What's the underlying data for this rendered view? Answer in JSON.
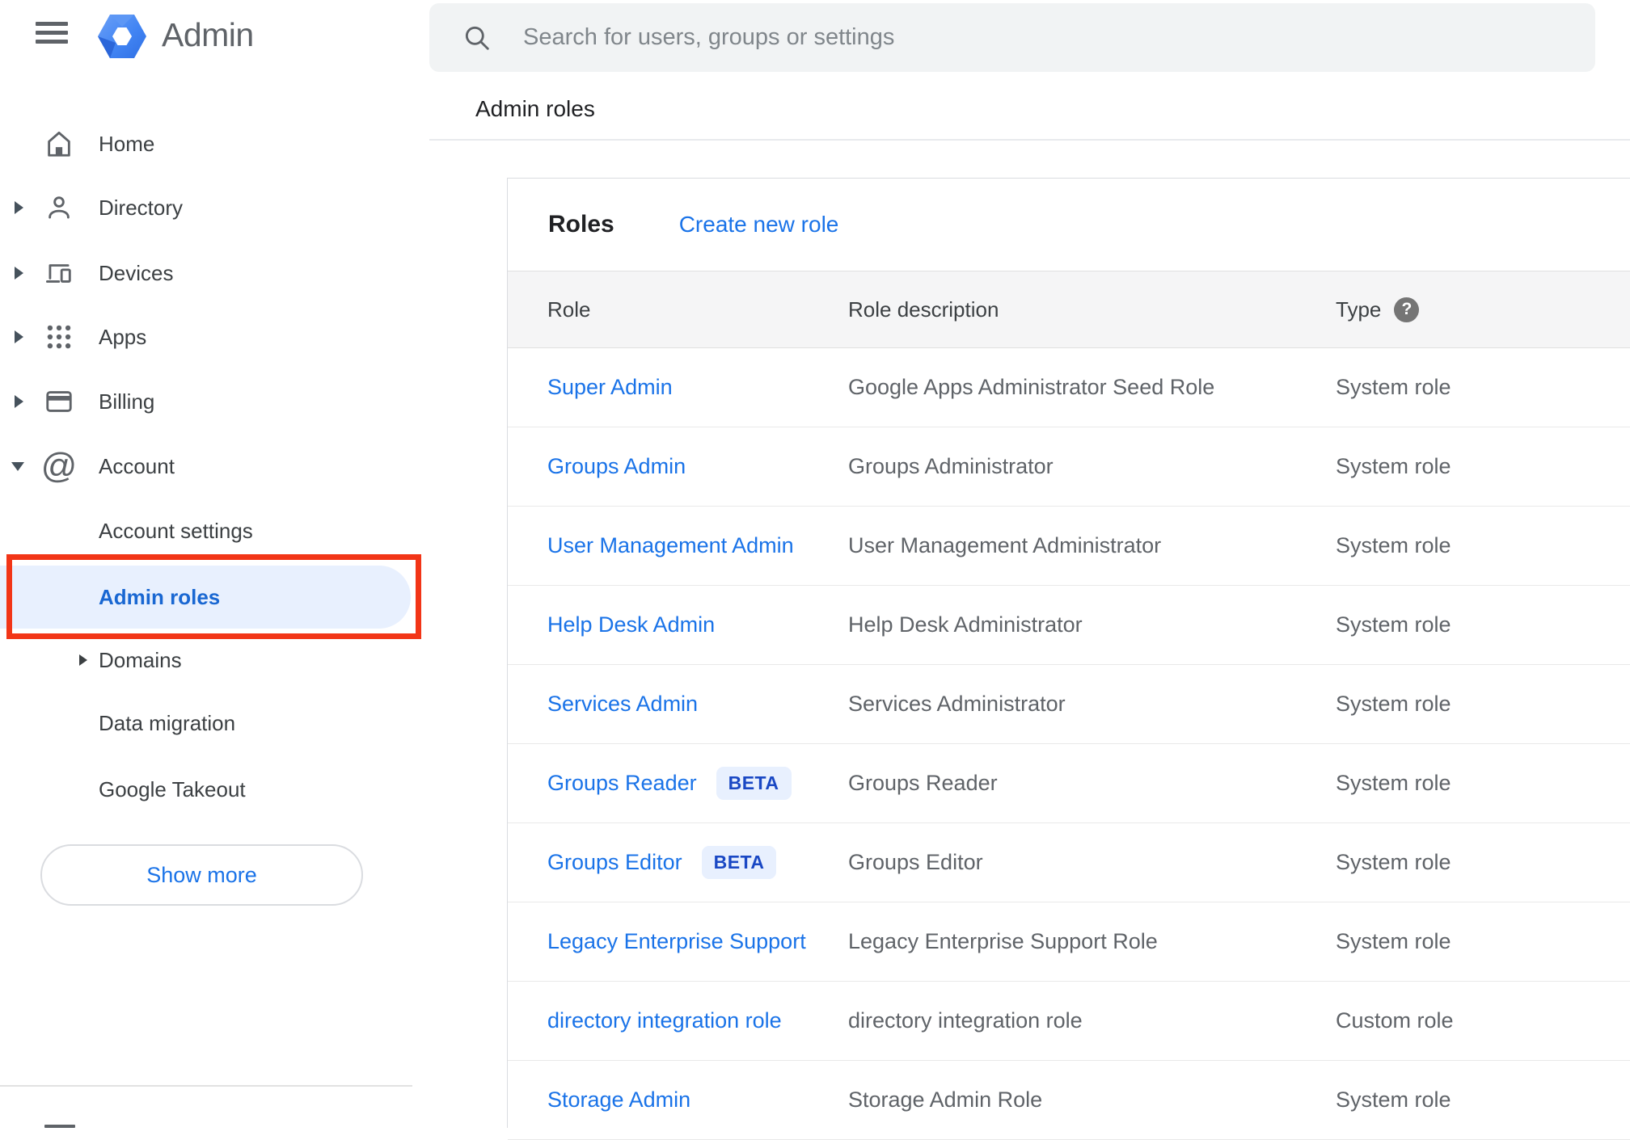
{
  "app": {
    "name": "Admin"
  },
  "topbar": {
    "search_placeholder": "Search for users, groups or settings"
  },
  "breadcrumb": {
    "title": "Admin roles"
  },
  "sidebar": {
    "items": [
      {
        "label": "Home",
        "icon": "home-icon",
        "expandable": false
      },
      {
        "label": "Directory",
        "icon": "person-icon",
        "expandable": true,
        "expanded": false
      },
      {
        "label": "Devices",
        "icon": "devices-icon",
        "expandable": true,
        "expanded": false
      },
      {
        "label": "Apps",
        "icon": "apps-grid-icon",
        "expandable": true,
        "expanded": false
      },
      {
        "label": "Billing",
        "icon": "credit-card-icon",
        "expandable": true,
        "expanded": false
      },
      {
        "label": "Account",
        "icon": "at-sign-icon",
        "expandable": true,
        "expanded": true
      }
    ],
    "account_children": [
      {
        "label": "Account settings",
        "selected": false
      },
      {
        "label": "Admin roles",
        "selected": true,
        "annotated": true
      },
      {
        "label": "Domains",
        "expandable": true
      },
      {
        "label": "Data migration"
      },
      {
        "label": "Google Takeout"
      }
    ],
    "show_more_label": "Show more"
  },
  "roles_panel": {
    "title": "Roles",
    "create_link": "Create new role",
    "columns": {
      "role": "Role",
      "description": "Role description",
      "type": "Type"
    },
    "help_glyph": "?",
    "rows": [
      {
        "role": "Super Admin",
        "description": "Google Apps Administrator Seed Role",
        "type": "System role"
      },
      {
        "role": "Groups Admin",
        "description": "Groups Administrator",
        "type": "System role"
      },
      {
        "role": "User Management Admin",
        "description": "User Management Administrator",
        "type": "System role"
      },
      {
        "role": "Help Desk Admin",
        "description": "Help Desk Administrator",
        "type": "System role"
      },
      {
        "role": "Services Admin",
        "description": "Services Administrator",
        "type": "System role"
      },
      {
        "role": "Groups Reader",
        "badge": "BETA",
        "description": "Groups Reader",
        "type": "System role"
      },
      {
        "role": "Groups Editor",
        "badge": "BETA",
        "description": "Groups Editor",
        "type": "System role"
      },
      {
        "role": "Legacy Enterprise Support",
        "description": "Legacy Enterprise Support Role",
        "type": "System role"
      },
      {
        "role": "directory integration role",
        "description": "directory integration role",
        "type": "Custom role"
      },
      {
        "role": "Storage Admin",
        "description": "Storage Admin Role",
        "type": "System role"
      }
    ]
  },
  "colors": {
    "link_blue": "#1a73e8",
    "selected_item_blue": "#1967d2",
    "selected_item_bg": "#e8f0fe",
    "beta_badge_bg": "#e8f0fe",
    "beta_badge_text": "#1a48c4",
    "annotation_red": "#f23517",
    "logo_blue": "#4285f4",
    "table_header_bg": "#f5f5f6"
  }
}
